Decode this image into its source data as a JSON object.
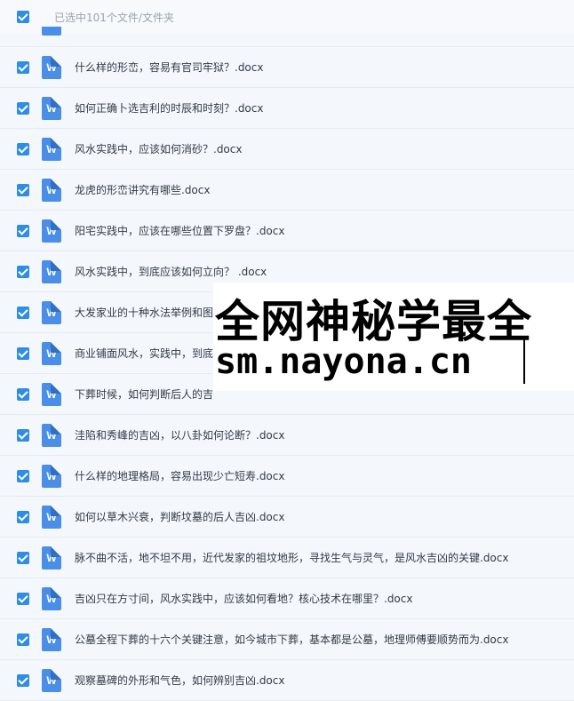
{
  "header": {
    "selection_label": "已选中101个文件/文件夹"
  },
  "files": [
    {
      "name": "什么样的形峦，容易有官司牢狱？.docx"
    },
    {
      "name": "如何正确卜选吉利的时辰和时刻？.docx"
    },
    {
      "name": "风水实践中，应该如何消砂？.docx"
    },
    {
      "name": "龙虎的形峦讲究有哪些.docx"
    },
    {
      "name": "阳宅实践中，应该在哪些位置下罗盘？.docx"
    },
    {
      "name": "风水实践中，到底应该如何立向？ .docx"
    },
    {
      "name": "大发家业的十种水法举例和图"
    },
    {
      "name": "商业铺面风水，实践中，到底"
    },
    {
      "name": "下葬时候，如何判断后人的吉"
    },
    {
      "name": "洼陷和秀峰的吉凶，以八卦如何论断？.docx"
    },
    {
      "name": "什么样的地理格局，容易出现少亡短寿.docx"
    },
    {
      "name": "如何以草木兴衰，判断坟墓的后人吉凶.docx"
    },
    {
      "name": "脉不曲不活，地不坦不用，近代发家的祖坟地形，寻找生气与灵气，是风水吉凶的关键.docx"
    },
    {
      "name": "吉凶只在方寸间，风水实践中，应该如何看地？核心技术在哪里？.docx"
    },
    {
      "name": "公墓全程下葬的十六个关键注意，如今城市下葬，基本都是公墓，地理师傅要顺势而为.docx"
    },
    {
      "name": "观察墓碑的外形和气色，如何辨别吉凶.docx"
    }
  ],
  "file_icon_letter": "W",
  "watermark": {
    "line1": "全网神秘学最全",
    "line2": "sm.nayona.cn"
  }
}
